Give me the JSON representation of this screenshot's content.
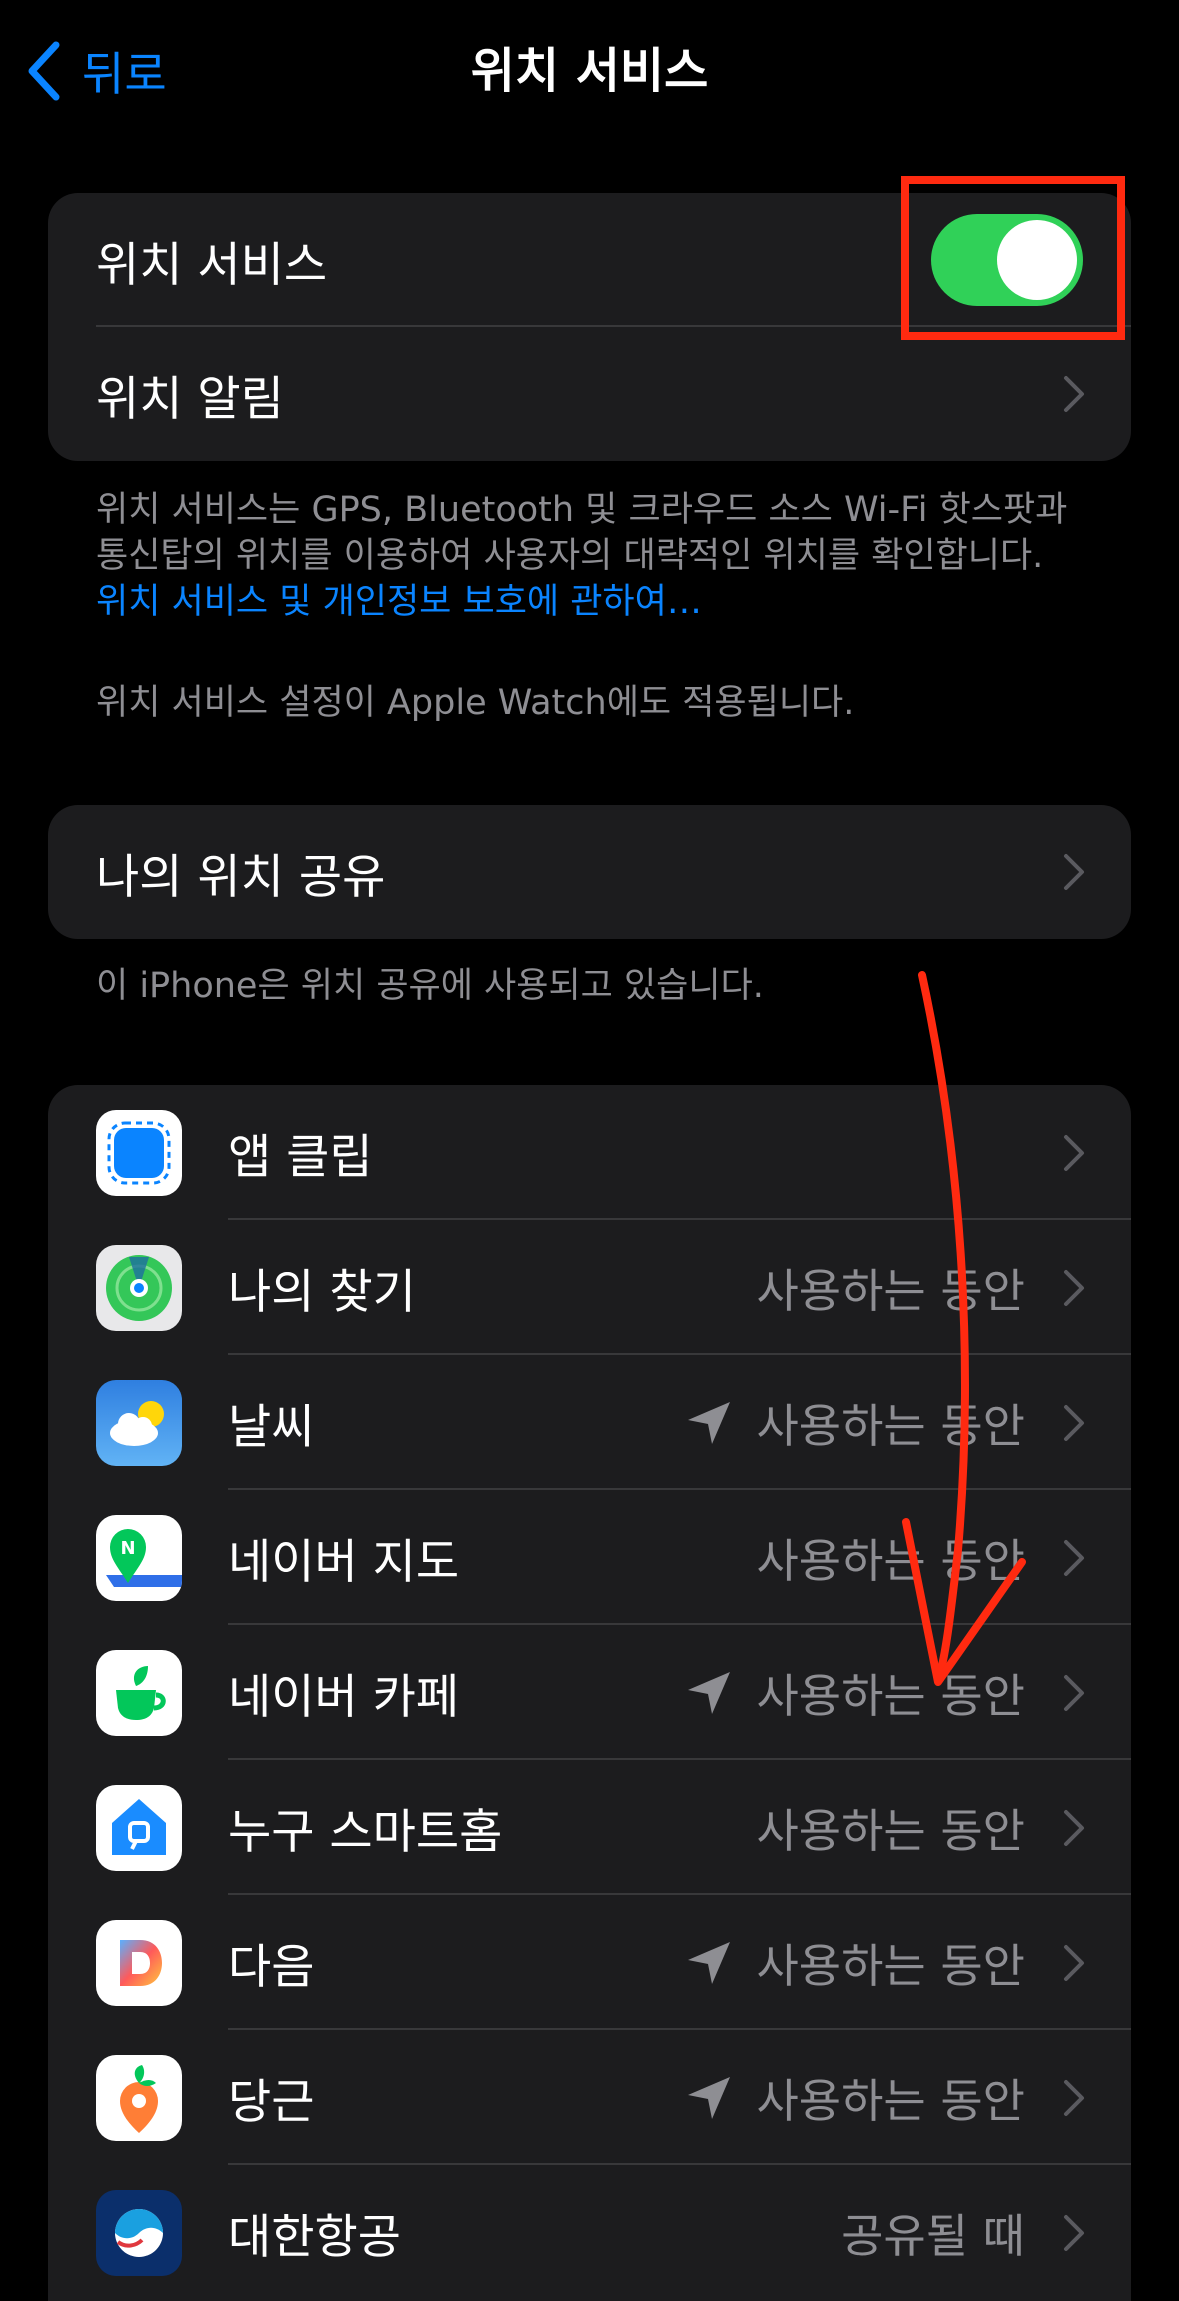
{
  "nav": {
    "back_label": "뒤로",
    "title": "위치 서비스"
  },
  "group1": {
    "location_services_label": "위치 서비스",
    "location_services_on": true,
    "location_alerts_label": "위치 알림"
  },
  "footnote1": {
    "text": "위치 서비스는 GPS, Bluetooth 및 크라우드 소스 Wi-Fi 핫스팟과 통신탑의 위치를 이용하여 사용자의 대략적인 위치를 확인합니다. ",
    "link": "위치 서비스 및 개인정보 보호에 관하여…",
    "watch_note": "위치 서비스 설정이 Apple Watch에도 적용됩니다."
  },
  "share": {
    "label": "나의 위치 공유",
    "note": "이 iPhone은 위치 공유에 사용되고 있습니다."
  },
  "apps": [
    {
      "name": "앱 클립",
      "status": "",
      "icon": "app-clip-icon",
      "recent": false
    },
    {
      "name": "나의 찾기",
      "status": "사용하는 동안",
      "icon": "find-my-icon",
      "recent": false
    },
    {
      "name": "날씨",
      "status": "사용하는 동안",
      "icon": "weather-icon",
      "recent": true
    },
    {
      "name": "네이버 지도",
      "status": "사용하는 동안",
      "icon": "naver-map-icon",
      "recent": false
    },
    {
      "name": "네이버 카페",
      "status": "사용하는 동안",
      "icon": "naver-cafe-icon",
      "recent": true
    },
    {
      "name": "누구 스마트홈",
      "status": "사용하는 동안",
      "icon": "nugu-smarthome-icon",
      "recent": false
    },
    {
      "name": "다음",
      "status": "사용하는 동안",
      "icon": "daum-icon",
      "recent": true
    },
    {
      "name": "당근",
      "status": "사용하는 동안",
      "icon": "daangn-icon",
      "recent": true
    },
    {
      "name": "대한항공",
      "status": "공유될 때",
      "icon": "korean-air-icon",
      "recent": false
    }
  ],
  "colors": {
    "accent": "#0a84ff",
    "toggle_on": "#30d158",
    "annotation": "#ff2a10"
  }
}
